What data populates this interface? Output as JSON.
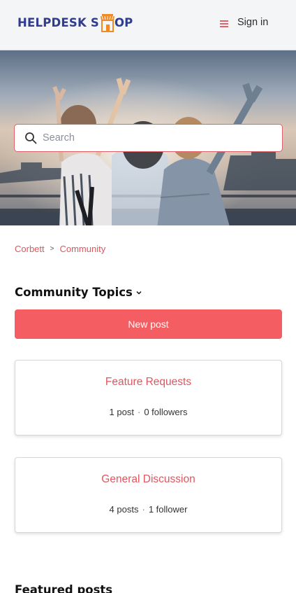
{
  "header": {
    "logo_part1": "HELPDESK S",
    "logo_part2": "OP",
    "sign_in": "Sign in"
  },
  "search": {
    "placeholder": "Search"
  },
  "breadcrumb": {
    "items": [
      "Corbett",
      "Community"
    ],
    "separator": ">"
  },
  "section": {
    "title": "Community Topics"
  },
  "actions": {
    "new_post": "New post"
  },
  "topics": [
    {
      "title": "Feature Requests",
      "posts": "1 post",
      "followers": "0 followers"
    },
    {
      "title": "General Discussion",
      "posts": "4 posts",
      "followers": "1 follower"
    }
  ],
  "featured": {
    "title": "Featured posts"
  },
  "colors": {
    "accent": "#f45d61",
    "link": "#e0555e",
    "logo": "#2f3c8f",
    "logo_accent": "#f08a24"
  }
}
